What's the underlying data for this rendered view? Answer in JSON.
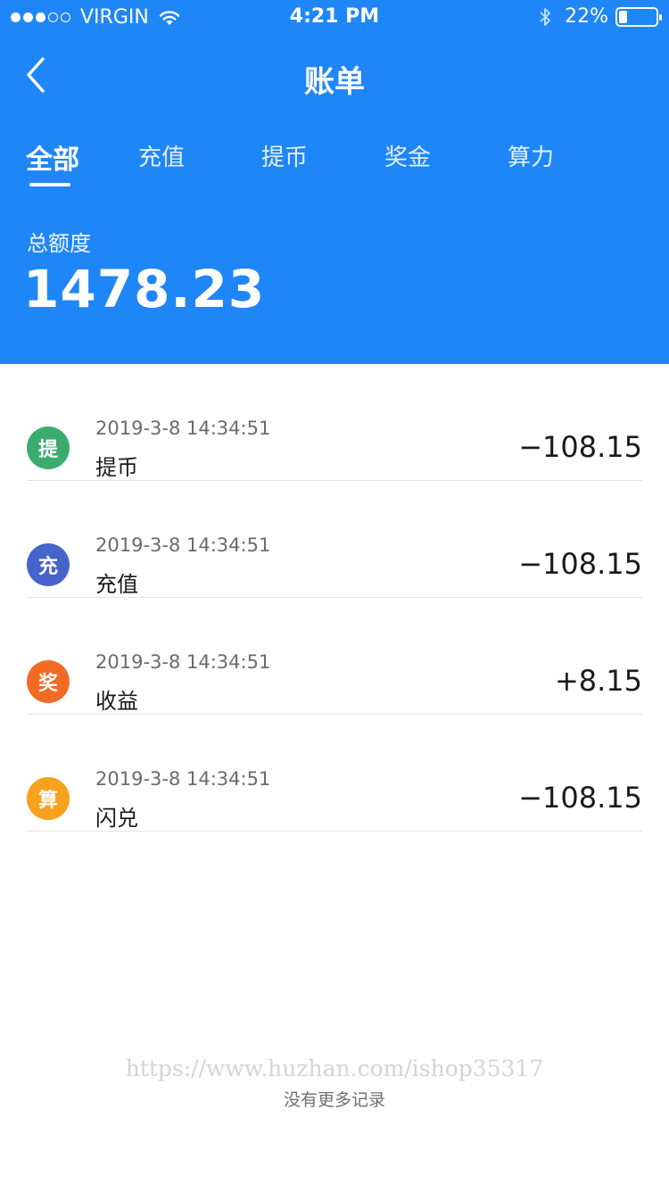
{
  "status_bar": {
    "carrier": "VIRGIN",
    "signal_bars_filled": 3,
    "signal_bars_total": 5,
    "time": "4:21 PM",
    "battery_text": "22%",
    "battery_level": 0.22
  },
  "nav": {
    "title": "账单",
    "back_icon": "chevron-left-icon"
  },
  "tabs": [
    {
      "label": "全部",
      "active": true
    },
    {
      "label": "充值",
      "active": false
    },
    {
      "label": "提币",
      "active": false
    },
    {
      "label": "奖金",
      "active": false
    },
    {
      "label": "算力",
      "active": false
    }
  ],
  "summary": {
    "label": "总额度",
    "value": "1478.23"
  },
  "records": [
    {
      "badge": "提",
      "badge_color": "#3bab6f",
      "time": "2019-3-8 14:34:51",
      "title": "提币",
      "amount": "−108.15"
    },
    {
      "badge": "充",
      "badge_color": "#4563c8",
      "time": "2019-3-8 14:34:51",
      "title": "充值",
      "amount": "−108.15"
    },
    {
      "badge": "奖",
      "badge_color": "#f26a24",
      "time": "2019-3-8 14:34:51",
      "title": "收益",
      "amount": "+8.15"
    },
    {
      "badge": "算",
      "badge_color": "#f7a11c",
      "time": "2019-3-8 14:34:51",
      "title": "闪兑",
      "amount": "−108.15"
    }
  ],
  "footer": {
    "watermark": "https://www.huzhan.com/ishop35317",
    "no_more": "没有更多记录"
  },
  "colors": {
    "header_bg": "#1f86f8"
  }
}
